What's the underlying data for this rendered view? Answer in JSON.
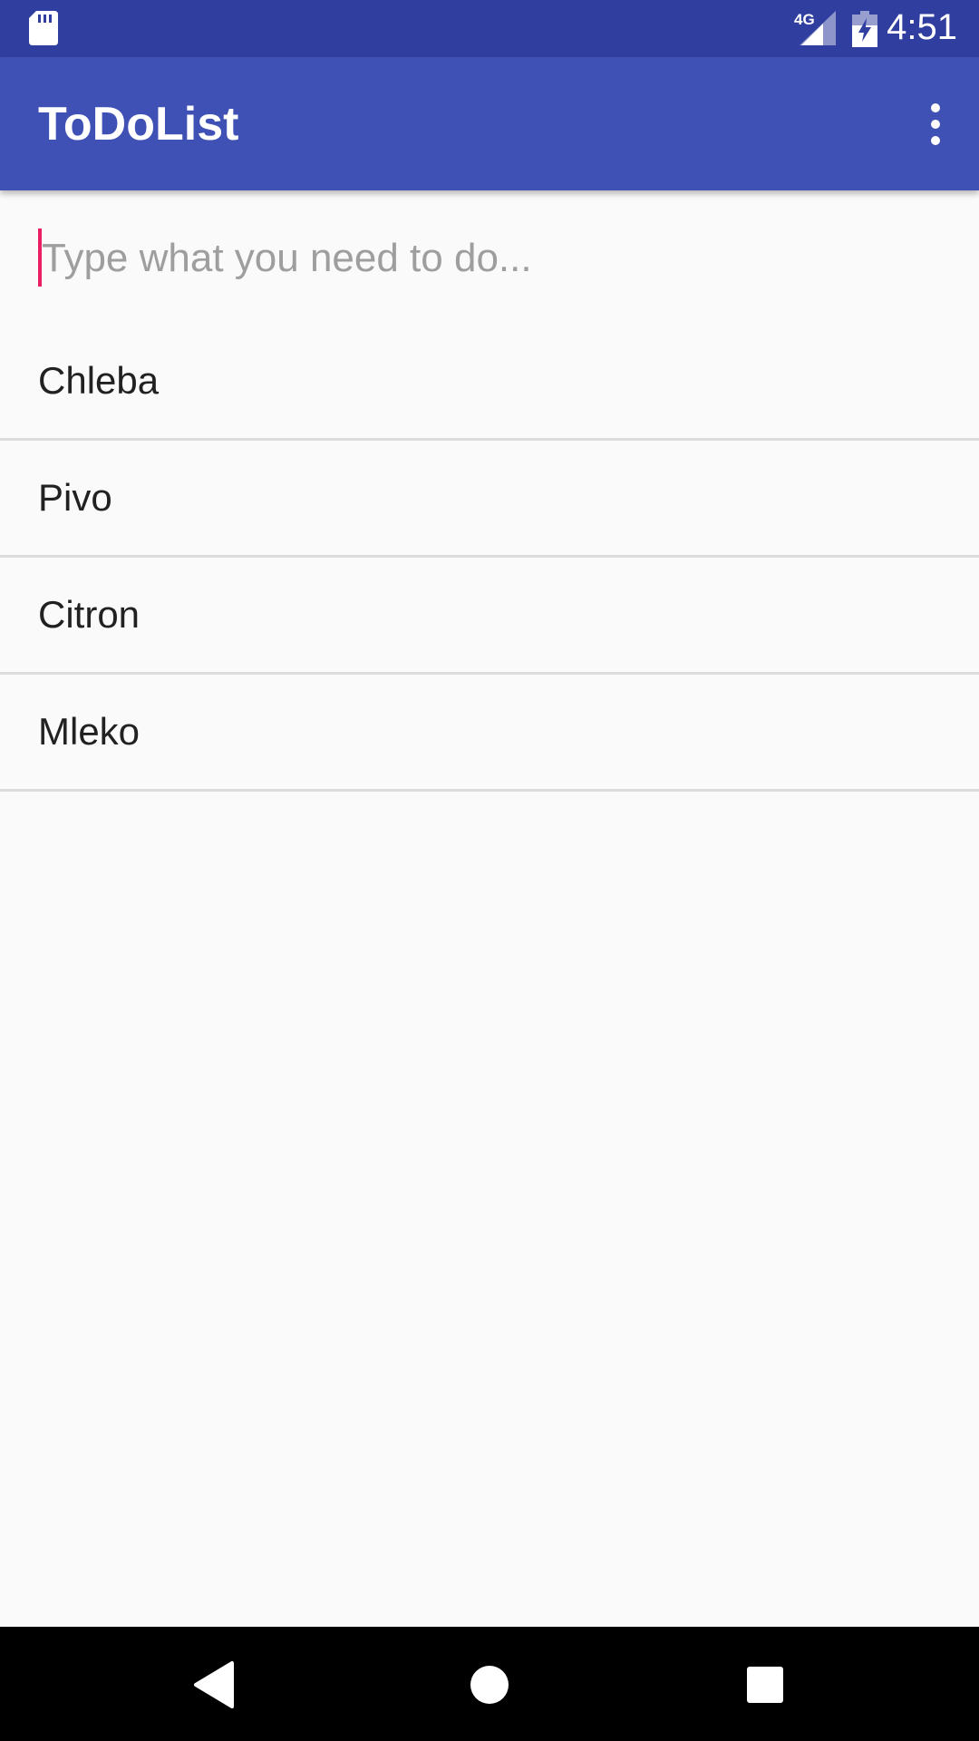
{
  "status_bar": {
    "time": "4:51",
    "network": "4G",
    "icons": [
      "sd-card-icon",
      "signal-icon",
      "battery-charging-icon"
    ]
  },
  "app_bar": {
    "title": "ToDoList",
    "menu_icon": "more-vert-icon"
  },
  "input": {
    "placeholder": "Type what you need to do...",
    "value": ""
  },
  "todos": [
    "Chleba",
    "Pivo",
    "Citron",
    "Mleko"
  ],
  "nav_bar": {
    "icons": [
      "back-icon",
      "home-icon",
      "recents-icon"
    ]
  },
  "colors": {
    "primary": "#3f51b5",
    "primary_dark": "#303f9f",
    "accent": "#ff4081",
    "background": "#fafafa"
  }
}
